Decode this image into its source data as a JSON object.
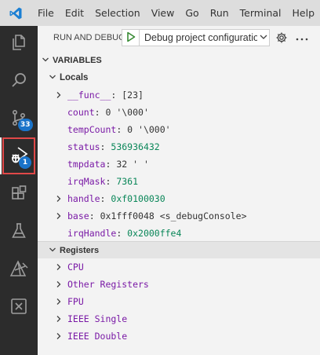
{
  "menubar": {
    "items": [
      "File",
      "Edit",
      "Selection",
      "View",
      "Go",
      "Run",
      "Terminal",
      "Help"
    ]
  },
  "activity_bar": {
    "items": [
      {
        "name": "explorer-icon",
        "badge": null
      },
      {
        "name": "search-icon",
        "badge": null
      },
      {
        "name": "source-control-icon",
        "badge": "33"
      },
      {
        "name": "run-and-debug-icon",
        "badge": "1",
        "active": true
      },
      {
        "name": "extensions-icon",
        "badge": null
      },
      {
        "name": "testing-icon",
        "badge": null
      },
      {
        "name": "embedded-tools-icon",
        "badge": null
      },
      {
        "name": "excel-icon",
        "badge": null
      }
    ]
  },
  "run": {
    "title": "RUN AND DEBUG",
    "config": "Debug project configuration"
  },
  "variables": {
    "header": "VARIABLES",
    "scope": "Locals",
    "items": [
      {
        "name": "__func__",
        "sep": ": ",
        "value": "[23]",
        "expandable": true,
        "kind": "str"
      },
      {
        "name": "count",
        "sep": ": ",
        "value": "0 '\\000'",
        "expandable": false,
        "kind": "str"
      },
      {
        "name": "tempCount",
        "sep": ": ",
        "value": "0 '\\000'",
        "expandable": false,
        "kind": "str"
      },
      {
        "name": "status",
        "sep": ": ",
        "value": "536936432",
        "expandable": false,
        "kind": "num"
      },
      {
        "name": "tmpdata",
        "sep": ": ",
        "value": "32 ' '",
        "expandable": false,
        "kind": "str"
      },
      {
        "name": "irqMask",
        "sep": ": ",
        "value": "7361",
        "expandable": false,
        "kind": "num"
      },
      {
        "name": "handle",
        "sep": ": ",
        "value": "0xf0100030",
        "expandable": true,
        "kind": "num"
      },
      {
        "name": "base",
        "sep": ": ",
        "value": "0x1fff0048 <s_debugConsole>",
        "expandable": true,
        "kind": "str"
      },
      {
        "name": "irqHandle",
        "sep": ": ",
        "value": "0x2000ffe4",
        "expandable": false,
        "kind": "num"
      }
    ]
  },
  "registers": {
    "header": "Registers",
    "items": [
      "CPU",
      "Other Registers",
      "FPU",
      "IEEE Single",
      "IEEE Double"
    ]
  },
  "colors": {
    "name": "#7a1aa6",
    "number": "#098658",
    "badge": "#1a73c9",
    "highlight": "#e04848"
  }
}
